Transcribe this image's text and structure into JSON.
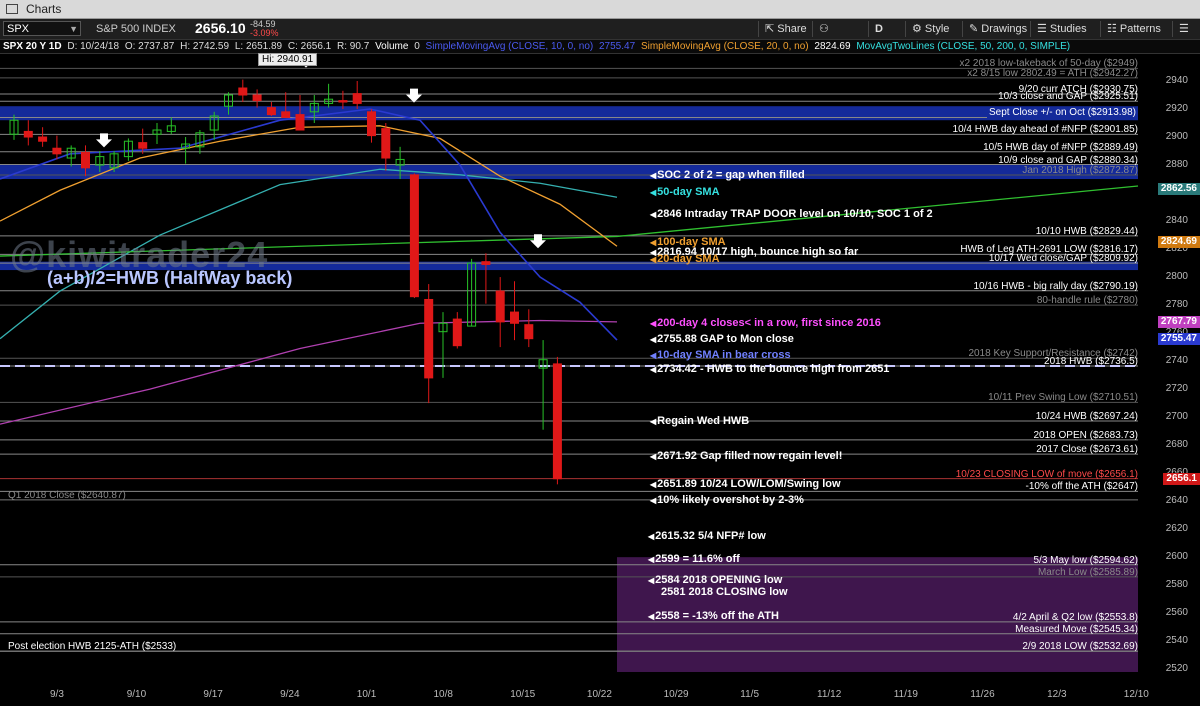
{
  "window": {
    "title": "Charts"
  },
  "toolbar": {
    "symbol": "SPX",
    "name": "S&P 500 INDEX",
    "last": "2656.10",
    "change": "-84.59",
    "change_pct": "-3.09%",
    "share": "Share",
    "style": "Style",
    "drawings": "Drawings",
    "studies": "Studies",
    "patterns": "Patterns",
    "d": "D"
  },
  "studybar": {
    "header": "SPX 20 Y 1D",
    "date": "D: 10/24/18",
    "open": "O: 2737.87",
    "high": "H: 2742.59",
    "low": "L: 2651.89",
    "close": "C: 2656.1",
    "r": "R: 90.7",
    "volume": "Volume",
    "vol_val": "0",
    "sma10": "SimpleMovingAvg (CLOSE, 10, 0, no)",
    "sma10_val": "2755.47",
    "sma20": "SimpleMovingAvg (CLOSE, 20, 0, no)",
    "sma20_val": "2824.69",
    "mav": "MovAvgTwoLines (CLOSE, 50, 200, 0, SIMPLE)"
  },
  "overlay": {
    "watermark": "@kiwitrader24",
    "hwb": "(a+b)/2=HWB (HalfWay back)",
    "hi_label": "Hi: 2940.91"
  },
  "levels_right": [
    {
      "text": "x2 2018 low-takeback of 50-day ($2949)",
      "price": 2949,
      "cls": "grey"
    },
    {
      "text": "x2 8/15 low 2802.49 = ATH ($2942.27)",
      "price": 2942.27,
      "cls": "grey"
    },
    {
      "text": "9/20 curr ATCH ($2930.75)",
      "price": 2930.75,
      "cls": ""
    },
    {
      "text": "10/3 close and GAP ($2925.51)",
      "price": 2925.51,
      "cls": ""
    },
    {
      "text": "Sept Close +/- on Oct ($2913.98)",
      "price": 2913.98,
      "cls": "hl"
    },
    {
      "text": "10/4 HWB day ahead of #NFP ($2901.85)",
      "price": 2901.85,
      "cls": ""
    },
    {
      "text": "10/5 HWB day of #NFP ($2889.49)",
      "price": 2889.49,
      "cls": ""
    },
    {
      "text": "10/9 close and GAP ($2880.34)",
      "price": 2880.34,
      "cls": ""
    },
    {
      "text": "Jan 2018 High ($2872.87)",
      "price": 2872.87,
      "cls": "grey"
    },
    {
      "text": "10/10 HWB ($2829.44)",
      "price": 2829.44,
      "cls": ""
    },
    {
      "text": "HWB of Leg ATH-2691 LOW ($2816.17)",
      "price": 2816.17,
      "cls": ""
    },
    {
      "text": "10/17 Wed close/GAP ($2809.92)",
      "price": 2809.92,
      "cls": ""
    },
    {
      "text": "10/16 HWB - big rally day ($2790.19)",
      "price": 2790.19,
      "cls": ""
    },
    {
      "text": "80-handle rule ($2780)",
      "price": 2780,
      "cls": "grey"
    },
    {
      "text": "2018 Key Support/Resistance ($2742)",
      "price": 2742,
      "cls": "grey"
    },
    {
      "text": "2018 HWB ($2736.5)",
      "price": 2736.5,
      "cls": ""
    },
    {
      "text": "10/11 Prev Swing Low ($2710.51)",
      "price": 2710.51,
      "cls": "grey"
    },
    {
      "text": "10/24 HWB ($2697.24)",
      "price": 2697.24,
      "cls": ""
    },
    {
      "text": "2018 OPEN ($2683.73)",
      "price": 2683.73,
      "cls": ""
    },
    {
      "text": "2017 Close ($2673.61)",
      "price": 2673.61,
      "cls": ""
    },
    {
      "text": "10/23 CLOSING LOW of move ($2656.1)",
      "price": 2656.1,
      "cls": "red"
    },
    {
      "text": "-10% off the ATH ($2647)",
      "price": 2647,
      "cls": ""
    },
    {
      "text": "5/3 May low ($2594.62)",
      "price": 2594.62,
      "cls": ""
    },
    {
      "text": "March Low ($2585.89)",
      "price": 2585.89,
      "cls": "grey"
    },
    {
      "text": "4/2 April & Q2 low ($2553.8)",
      "price": 2553.8,
      "cls": ""
    },
    {
      "text": "Measured Move ($2545.34)",
      "price": 2545.34,
      "cls": ""
    },
    {
      "text": "2/9 2018 LOW ($2532.69)",
      "price": 2532.69,
      "cls": ""
    }
  ],
  "levels_left": [
    {
      "text": "Q1 2018 Close ($2640.87)",
      "price": 2640.87
    },
    {
      "text": "Post election HWB 2125-ATH ($2533)",
      "price": 2533
    }
  ],
  "notes": [
    {
      "text": "SOC 2 of 2 = gap when filled",
      "price": 2873,
      "color": "#ffffff"
    },
    {
      "text": "50-day SMA",
      "price": 2861,
      "color": "#35e0e0"
    },
    {
      "text": "2846 Intraday TRAP DOOR level on 10/10, SOC 1 of 2",
      "price": 2845,
      "color": "#ffffff"
    },
    {
      "text": "100-day SMA",
      "price": 2825,
      "color": "#f0a030"
    },
    {
      "text": "2816.94 10/17 high, bounce high so far",
      "price": 2818,
      "color": "#ffffff"
    },
    {
      "text": "20-day SMA",
      "price": 2813,
      "color": "#f0a030"
    },
    {
      "text": "200-day 4 closes< in a row, first since 2016",
      "price": 2767,
      "color": "#ff50ff"
    },
    {
      "text": "2755.88 GAP to Mon close",
      "price": 2756,
      "color": "#ffffff"
    },
    {
      "text": "10-day SMA in bear cross",
      "price": 2744,
      "color": "#7080ff"
    },
    {
      "text": "2734.42 - HWB to the bounce high from 2651",
      "price": 2734,
      "color": "#ffffff"
    },
    {
      "text": "Regain Wed HWB",
      "price": 2697,
      "color": "#ffffff"
    },
    {
      "text": "2671.92 Gap filled now regain level!",
      "price": 2672,
      "color": "#ffffff"
    },
    {
      "text": "2651.89 10/24 LOW/LOM/Swing low",
      "price": 2652,
      "color": "#ffffff"
    },
    {
      "text": "10% likely overshot by 2-3%",
      "price": 2641,
      "color": "#ffffff"
    },
    {
      "text": "2615.32 5/4 NFP# low",
      "price": 2615,
      "color": "#ffffff"
    },
    {
      "text": "2599 = 11.6% off",
      "price": 2599,
      "color": "#ffffff"
    },
    {
      "text": "2584 2018 OPENING low",
      "price": 2584,
      "color": "#ffffff"
    },
    {
      "text": "2581 2018 CLOSING low",
      "price": 2575,
      "color": "#ffffff",
      "nomark": true
    },
    {
      "text": "2558 = -13% off the ATH",
      "price": 2558,
      "color": "#ffffff"
    }
  ],
  "y_axis": [
    "2940",
    "2920",
    "2900",
    "2880",
    "2860",
    "2840",
    "2820",
    "2800",
    "2780",
    "2760",
    "2740",
    "2720",
    "2700",
    "2680",
    "2660",
    "2640",
    "2620",
    "2600",
    "2580",
    "2560",
    "2540",
    "2520"
  ],
  "price_boxes": [
    {
      "text": "2862.56",
      "price": 2862.56,
      "bg": "#2a7a7a"
    },
    {
      "text": "2824.69",
      "price": 2824.69,
      "bg": "#d07a10"
    },
    {
      "text": "2767.79",
      "price": 2767.79,
      "bg": "#c040c0"
    },
    {
      "text": "2755.47",
      "price": 2755.47,
      "bg": "#2a3ad0"
    },
    {
      "text": "2656.1",
      "price": 2656.1,
      "bg": "#d01818"
    }
  ],
  "x_axis": [
    "9/3",
    "9/10",
    "9/17",
    "9/24",
    "10/1",
    "10/8",
    "10/15",
    "10/22",
    "10/29",
    "11/5",
    "11/12",
    "11/19",
    "11/26",
    "12/3",
    "12/10"
  ],
  "candles": [
    {
      "o": 2902,
      "h": 2916,
      "l": 2898,
      "c": 2912
    },
    {
      "o": 2904,
      "h": 2912,
      "l": 2894,
      "c": 2900
    },
    {
      "o": 2900,
      "h": 2907,
      "l": 2893,
      "c": 2897
    },
    {
      "o": 2892,
      "h": 2901,
      "l": 2884,
      "c": 2888
    },
    {
      "o": 2885,
      "h": 2894,
      "l": 2879,
      "c": 2892
    },
    {
      "o": 2889,
      "h": 2894,
      "l": 2872,
      "c": 2878
    },
    {
      "o": 2880,
      "h": 2890,
      "l": 2875,
      "c": 2886
    },
    {
      "o": 2878,
      "h": 2890,
      "l": 2875,
      "c": 2888
    },
    {
      "o": 2886,
      "h": 2899,
      "l": 2883,
      "c": 2897
    },
    {
      "o": 2896,
      "h": 2906,
      "l": 2888,
      "c": 2892
    },
    {
      "o": 2902,
      "h": 2910,
      "l": 2895,
      "c": 2905
    },
    {
      "o": 2904,
      "h": 2914,
      "l": 2902,
      "c": 2908
    },
    {
      "o": 2892,
      "h": 2900,
      "l": 2881,
      "c": 2895
    },
    {
      "o": 2893,
      "h": 2905,
      "l": 2888,
      "c": 2903
    },
    {
      "o": 2905,
      "h": 2918,
      "l": 2898,
      "c": 2915
    },
    {
      "o": 2922,
      "h": 2932,
      "l": 2916,
      "c": 2930
    },
    {
      "o": 2935,
      "h": 2941,
      "l": 2925,
      "c": 2930
    },
    {
      "o": 2930,
      "h": 2934,
      "l": 2921,
      "c": 2926
    },
    {
      "o": 2921,
      "h": 2925,
      "l": 2915,
      "c": 2916
    },
    {
      "o": 2918,
      "h": 2932,
      "l": 2915,
      "c": 2914
    },
    {
      "o": 2916,
      "h": 2930,
      "l": 2905,
      "c": 2905
    },
    {
      "o": 2918,
      "h": 2930,
      "l": 2910,
      "c": 2924
    },
    {
      "o": 2924,
      "h": 2938,
      "l": 2921,
      "c": 2927
    },
    {
      "o": 2926,
      "h": 2933,
      "l": 2920,
      "c": 2925
    },
    {
      "o": 2931,
      "h": 2940,
      "l": 2920,
      "c": 2924
    },
    {
      "o": 2918,
      "h": 2920,
      "l": 2896,
      "c": 2901
    },
    {
      "o": 2906,
      "h": 2910,
      "l": 2876,
      "c": 2885
    },
    {
      "o": 2880,
      "h": 2893,
      "l": 2870,
      "c": 2884
    },
    {
      "o": 2873,
      "h": 2874,
      "l": 2785,
      "c": 2786
    },
    {
      "o": 2784,
      "h": 2795,
      "l": 2710,
      "c": 2728
    },
    {
      "o": 2761,
      "h": 2775,
      "l": 2728,
      "c": 2767
    },
    {
      "o": 2770,
      "h": 2775,
      "l": 2749,
      "c": 2751
    },
    {
      "o": 2765,
      "h": 2813,
      "l": 2765,
      "c": 2810
    },
    {
      "o": 2811,
      "h": 2817,
      "l": 2781,
      "c": 2809
    },
    {
      "o": 2790,
      "h": 2800,
      "l": 2750,
      "c": 2768
    },
    {
      "o": 2775,
      "h": 2797,
      "l": 2755,
      "c": 2767
    },
    {
      "o": 2766,
      "h": 2777,
      "l": 2750,
      "c": 2756
    },
    {
      "o": 2735,
      "h": 2755,
      "l": 2691,
      "c": 2741
    },
    {
      "o": 2738,
      "h": 2743,
      "l": 2652,
      "c": 2656
    }
  ],
  "colors": {
    "up": "#27c227",
    "down": "#e01818",
    "sma10": "#2a3ad0",
    "sma20": "#f0a030",
    "sma50": "#35b0b0",
    "sma200": "#b040b0",
    "line100": "#30c030"
  }
}
